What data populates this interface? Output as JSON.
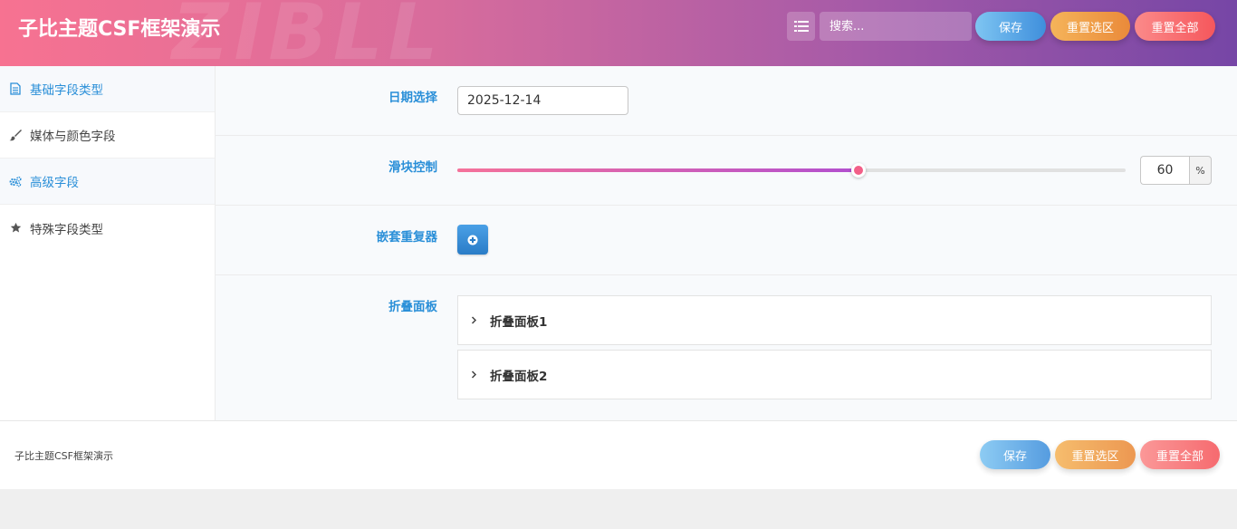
{
  "header": {
    "title": "子比主题CSF框架演示",
    "watermark": "ZIBLL",
    "search_placeholder": "搜索...",
    "save_label": "保存",
    "reset_section_label": "重置选区",
    "reset_all_label": "重置全部"
  },
  "sidebar": {
    "items": [
      {
        "label": "基础字段类型",
        "icon": "document-icon",
        "active": true
      },
      {
        "label": "媒体与颜色字段",
        "icon": "brush-icon",
        "active": false
      },
      {
        "label": "高级字段",
        "icon": "gears-icon",
        "active": true
      },
      {
        "label": "特殊字段类型",
        "icon": "star-icon",
        "active": false
      }
    ]
  },
  "main": {
    "date": {
      "label": "日期选择",
      "value": "2025-12-14"
    },
    "slider": {
      "label": "滑块控制",
      "value": 60,
      "unit": "%",
      "min": 0,
      "max": 100
    },
    "repeater": {
      "label": "嵌套重复器"
    },
    "accordion": {
      "label": "折叠面板",
      "panels": [
        "折叠面板1",
        "折叠面板2"
      ]
    }
  },
  "footer": {
    "text": "子比主题CSF框架演示",
    "save_label": "保存",
    "reset_section_label": "重置选区",
    "reset_all_label": "重置全部"
  },
  "colors": {
    "accent": "#2a8fd8",
    "header_start": "#f77291",
    "header_end": "#7646a6",
    "save": "#3f8fdc",
    "reset_section": "#ea8a3a",
    "reset_all": "#f5575c"
  }
}
